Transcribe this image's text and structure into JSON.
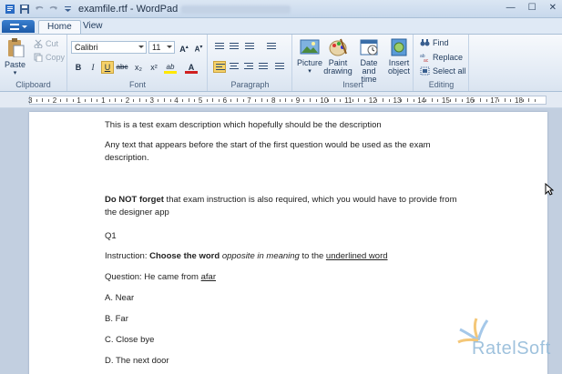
{
  "window": {
    "title": "examfile.rtf - WordPad",
    "minimize": "—",
    "maximize": "☐",
    "close": "✕"
  },
  "tabs": [
    {
      "label": "Home"
    },
    {
      "label": "View"
    }
  ],
  "clipboard": {
    "paste": "Paste",
    "cut": "Cut",
    "copy": "Copy",
    "label": "Clipboard"
  },
  "font": {
    "family": "Calibri",
    "size": "11",
    "label": "Font",
    "grow": "A",
    "shrink": "A",
    "bold": "B",
    "italic": "I",
    "underline": "U",
    "strike": "abc",
    "subscript": "x₂",
    "superscript": "x²",
    "highlight": "ab",
    "color": "A"
  },
  "paragraph": {
    "label": "Paragraph"
  },
  "insert": {
    "picture": "Picture",
    "paint": "Paint\ndrawing",
    "paint_l1": "Paint",
    "paint_l2": "drawing",
    "datetime_l1": "Date and",
    "datetime_l2": "time",
    "object_l1": "Insert",
    "object_l2": "object",
    "label": "Insert"
  },
  "editing": {
    "find": "Find",
    "replace": "Replace",
    "select_all": "Select all",
    "label": "Editing"
  },
  "ruler": {
    "labels": [
      "3",
      "2",
      "1",
      "1",
      "2",
      "3",
      "4",
      "5",
      "6",
      "7",
      "8",
      "9",
      "10",
      "11",
      "12",
      "13",
      "14",
      "15",
      "16",
      "17",
      "18"
    ]
  },
  "document": {
    "line1": "This is a test exam description which hopefully should be the description",
    "line2": "Any text that appears before the start of the first question would be used as the exam",
    "line2b": "description.",
    "line3_bold": "Do NOT forget",
    "line3_rest": " that exam instruction is also required, which you would have to provide from",
    "line3b": "the designer app",
    "q1": "Q1",
    "instr_prefix": "Instruction: ",
    "instr_bold": "Choose the word",
    "instr_space": " ",
    "instr_italic": "opposite in meaning",
    "instr_mid": " to the ",
    "instr_underline": "underlined word",
    "question_prefix": "Question: He came from ",
    "question_underline": "afar",
    "option_a": "A. Near",
    "option_b": "B. Far",
    "option_c": "C. Close bye",
    "option_d": "D. The next door"
  },
  "watermark": {
    "text": "RatelSoft"
  },
  "colors": {
    "accent": "#1c5aa8",
    "highlight_button": "#f7d26a",
    "watermark": "#8fb8d8"
  }
}
